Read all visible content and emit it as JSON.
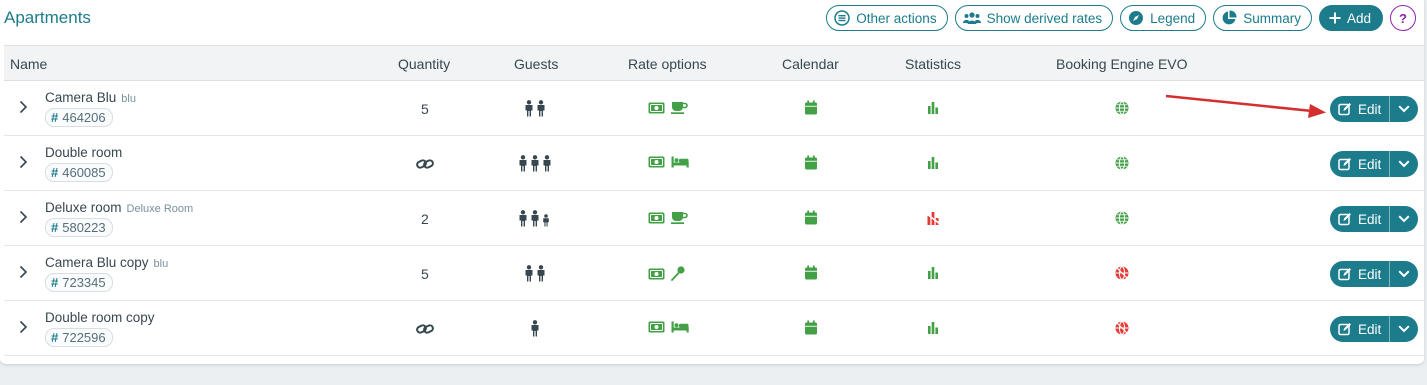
{
  "title": "Apartments",
  "toolbar": {
    "other_actions": "Other actions",
    "show_derived_rates": "Show derived rates",
    "legend": "Legend",
    "summary": "Summary",
    "add": "Add",
    "help": "?"
  },
  "columns": {
    "name": "Name",
    "quantity": "Quantity",
    "guests": "Guests",
    "rate_options": "Rate options",
    "calendar": "Calendar",
    "statistics": "Statistics",
    "booking_engine": "Booking Engine EVO"
  },
  "rows": [
    {
      "name": "Camera Blu",
      "sub": "blu",
      "code": "464206",
      "quantity": "5",
      "guests": [
        "adult",
        "adult"
      ],
      "rate_icons": [
        "money-icon",
        "coffee-icon"
      ],
      "stats": "ok",
      "booking": "ok",
      "edit": "Edit"
    },
    {
      "name": "Double room",
      "sub": "",
      "code": "460085",
      "quantity": "",
      "quantity_icon": "link-icon",
      "guests": [
        "adult",
        "adult",
        "adult"
      ],
      "rate_icons": [
        "money-icon",
        "bed-icon"
      ],
      "stats": "ok",
      "booking": "ok",
      "edit": "Edit"
    },
    {
      "name": "Deluxe room",
      "sub": "Deluxe Room",
      "code": "580223",
      "quantity": "2",
      "guests": [
        "adult",
        "adult",
        "child"
      ],
      "rate_icons": [
        "money-icon",
        "coffee-icon"
      ],
      "stats": "error",
      "booking": "ok",
      "edit": "Edit"
    },
    {
      "name": "Camera Blu copy",
      "sub": "blu",
      "code": "723345",
      "quantity": "5",
      "guests": [
        "adult",
        "adult"
      ],
      "rate_icons": [
        "money-icon",
        "pin-icon"
      ],
      "stats": "ok",
      "booking": "error",
      "edit": "Edit"
    },
    {
      "name": "Double room copy",
      "sub": "",
      "code": "722596",
      "quantity": "",
      "quantity_icon": "link-icon",
      "guests": [
        "adult"
      ],
      "rate_icons": [
        "money-icon",
        "bed-icon"
      ],
      "stats": "ok",
      "booking": "error",
      "edit": "Edit"
    }
  ],
  "colors": {
    "teal": "#1c7c8c",
    "green": "#43a047",
    "red": "#e53935",
    "annotation_arrow": "#d32f2f"
  }
}
